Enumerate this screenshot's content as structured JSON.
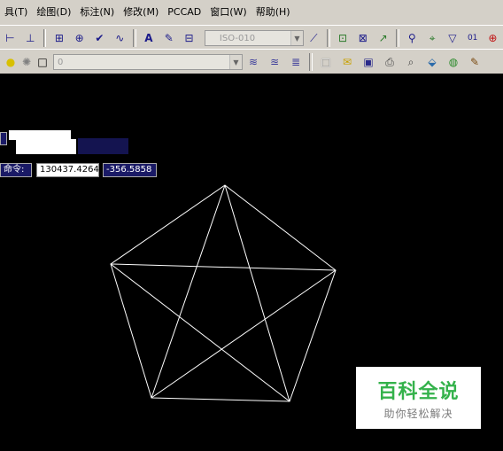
{
  "menu": [
    {
      "label": "具(T)"
    },
    {
      "label": "绘图(D)"
    },
    {
      "label": "标注(N)"
    },
    {
      "label": "修改(M)"
    },
    {
      "label": "PCCAD"
    },
    {
      "label": "窗口(W)"
    },
    {
      "label": "帮助(H)"
    }
  ],
  "toolbar": {
    "dimstyle_value": "ISO-010",
    "layer_value": "0"
  },
  "command": {
    "label": "命令:",
    "x_value": "130437.4264",
    "y_value": "-356.5858"
  },
  "watermark": {
    "title": "百科全说",
    "subtitle": "助你轻松解决"
  },
  "colors": {
    "canvas": "#000000",
    "toolbar": "#d4d0c8",
    "drawing": "#ffffff",
    "watermark_green": "#34b24b"
  }
}
